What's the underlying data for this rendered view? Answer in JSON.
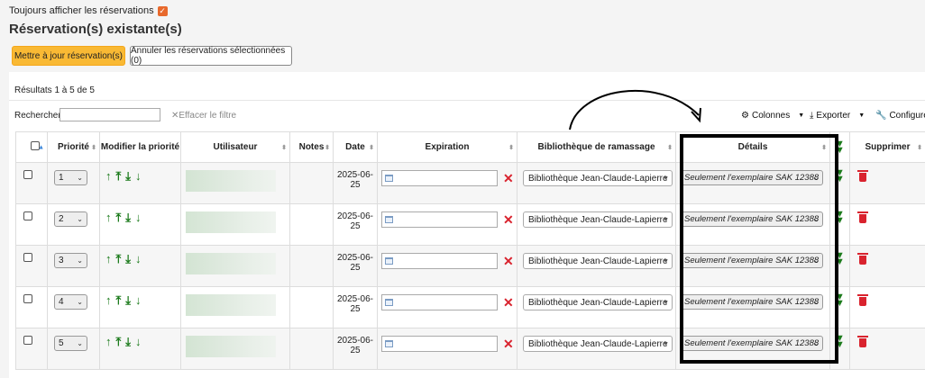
{
  "top_toggle": {
    "label": "Toujours afficher les réservations"
  },
  "section_title": "Réservation(s) existante(s)",
  "buttons": {
    "update": "Mettre à jour réservation(s)",
    "cancel_selected": "Annuler les réservations sélectionnées (0)"
  },
  "results_info": "Résultats 1 à 5 de 5",
  "search": {
    "label": "Rechercher :",
    "clear": "Effacer le filtre"
  },
  "toolbar": {
    "columns": "Colonnes",
    "export": "Exporter",
    "configure": "Configurer"
  },
  "columns": [
    "Priorité",
    "Modifier la priorité",
    "Utilisateur",
    "Notes",
    "Date",
    "Expiration",
    "Bibliothèque de ramassage",
    "Détails",
    "Supprimer"
  ],
  "arrows": [
    "↑",
    "⤒",
    "⤓",
    "↓"
  ],
  "rows": [
    {
      "priority": "1",
      "date": "2025-06-25",
      "library": "Bibliothèque Jean-Claude-Lapierre",
      "details": "Seulement l'exemplaire SAK 12388"
    },
    {
      "priority": "2",
      "date": "2025-06-25",
      "library": "Bibliothèque Jean-Claude-Lapierre",
      "details": "Seulement l'exemplaire SAK 12388"
    },
    {
      "priority": "3",
      "date": "2025-06-25",
      "library": "Bibliothèque Jean-Claude-Lapierre",
      "details": "Seulement l'exemplaire SAK 12388"
    },
    {
      "priority": "4",
      "date": "2025-06-25",
      "library": "Bibliothèque Jean-Claude-Lapierre",
      "details": "Seulement l'exemplaire SAK 12388"
    },
    {
      "priority": "5",
      "date": "2025-06-25",
      "library": "Bibliothèque Jean-Claude-Lapierre",
      "details": "Seulement l'exemplaire SAK 12388"
    }
  ],
  "colors": {
    "accent_button": "#f9b934",
    "checkbox": "#e8692c",
    "action_green": "#1a7a1a",
    "delete_red": "#d9232e"
  }
}
